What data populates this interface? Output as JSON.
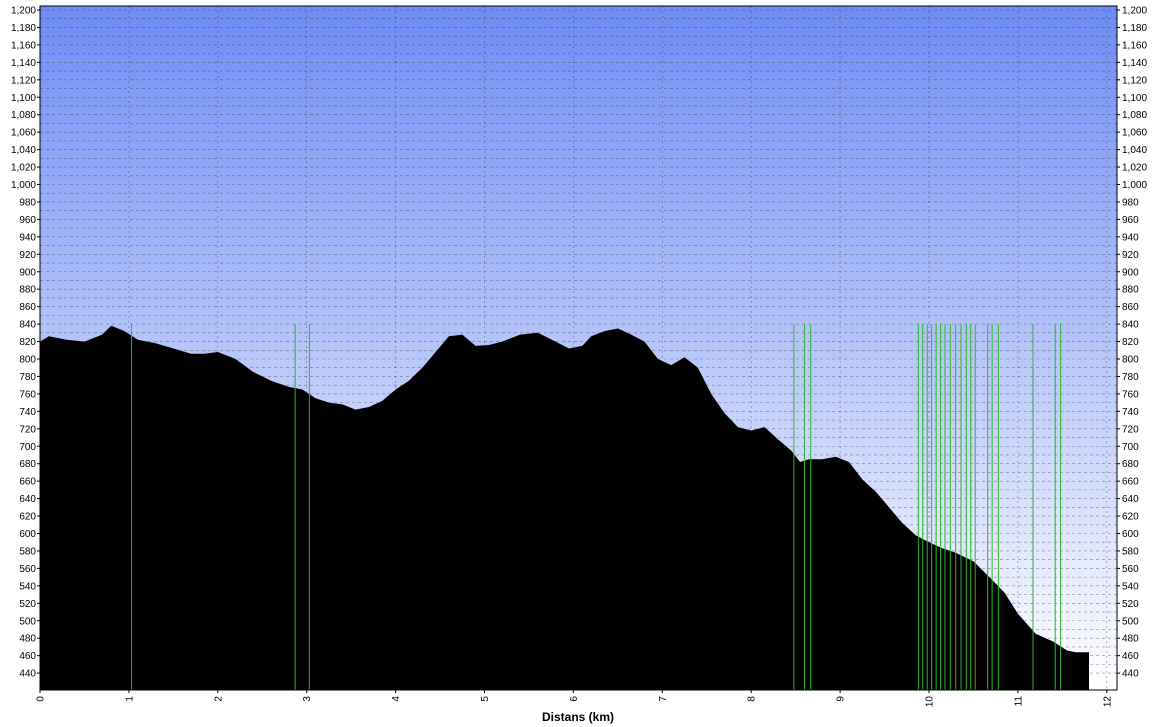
{
  "chart_data": {
    "type": "area",
    "title": "",
    "xlabel": "Distans (km)",
    "ylabel": "",
    "xlim": [
      0,
      12
    ],
    "ylim": [
      430,
      1200
    ],
    "x_ticks": [
      "0",
      "1",
      "2",
      "3",
      "4",
      "5",
      "6",
      "7",
      "8",
      "9",
      "10",
      "11",
      "12"
    ],
    "y_ticks": [
      "440",
      "460",
      "480",
      "500",
      "520",
      "540",
      "560",
      "580",
      "600",
      "620",
      "640",
      "660",
      "680",
      "700",
      "720",
      "740",
      "760",
      "780",
      "800",
      "820",
      "840",
      "860",
      "880",
      "900",
      "920",
      "940",
      "960",
      "980",
      "1,000",
      "1,020",
      "1,040",
      "1,060",
      "1,080",
      "1,100",
      "1,120",
      "1,140",
      "1,160",
      "1,180",
      "1,200"
    ],
    "grid": true,
    "background_gradient": [
      "#6e8cf5",
      "#ffffff"
    ],
    "fill_color": "#000000",
    "marker_color": "#2db52d",
    "series": [
      {
        "x": [
          0,
          0.1,
          0.3,
          0.5,
          0.7,
          0.8,
          0.95,
          1.1,
          1.3,
          1.5,
          1.7,
          1.85,
          2.0,
          2.2,
          2.4,
          2.6,
          2.8,
          2.95,
          3.1,
          3.25,
          3.4,
          3.55,
          3.7,
          3.85,
          4.0,
          4.15,
          4.3,
          4.45,
          4.6,
          4.75,
          4.9,
          5.05,
          5.2,
          5.4,
          5.6,
          5.8,
          5.95,
          6.1,
          6.2,
          6.35,
          6.5,
          6.65,
          6.8,
          6.95,
          7.1,
          7.25,
          7.4,
          7.55,
          7.7,
          7.85,
          8.0,
          8.15,
          8.3,
          8.45,
          8.55,
          8.65,
          8.8,
          8.95,
          9.1,
          9.25,
          9.4,
          9.55,
          9.7,
          9.85,
          10.0,
          10.15,
          10.3,
          10.5,
          10.7,
          10.85,
          11.0,
          11.2,
          11.4,
          11.55,
          11.65,
          11.8
        ],
        "y": [
          820,
          826,
          822,
          820,
          828,
          838,
          832,
          822,
          818,
          812,
          806,
          806,
          808,
          800,
          785,
          775,
          768,
          765,
          755,
          750,
          748,
          742,
          745,
          752,
          765,
          775,
          790,
          808,
          826,
          828,
          815,
          816,
          820,
          828,
          830,
          820,
          812,
          815,
          826,
          832,
          835,
          828,
          820,
          800,
          793,
          802,
          790,
          760,
          738,
          722,
          718,
          722,
          708,
          695,
          682,
          685,
          685,
          688,
          682,
          662,
          648,
          630,
          612,
          598,
          590,
          583,
          578,
          568,
          548,
          532,
          508,
          485,
          476,
          466,
          464,
          464
        ]
      }
    ],
    "markers_x": [
      1.03,
      2.87,
      3.03,
      8.48,
      8.6,
      8.67,
      9.88,
      9.93,
      9.98,
      10.03,
      10.08,
      10.13,
      10.18,
      10.24,
      10.3,
      10.36,
      10.42,
      10.47,
      10.52,
      10.66,
      10.71,
      10.78,
      11.17,
      11.42,
      11.48
    ]
  }
}
